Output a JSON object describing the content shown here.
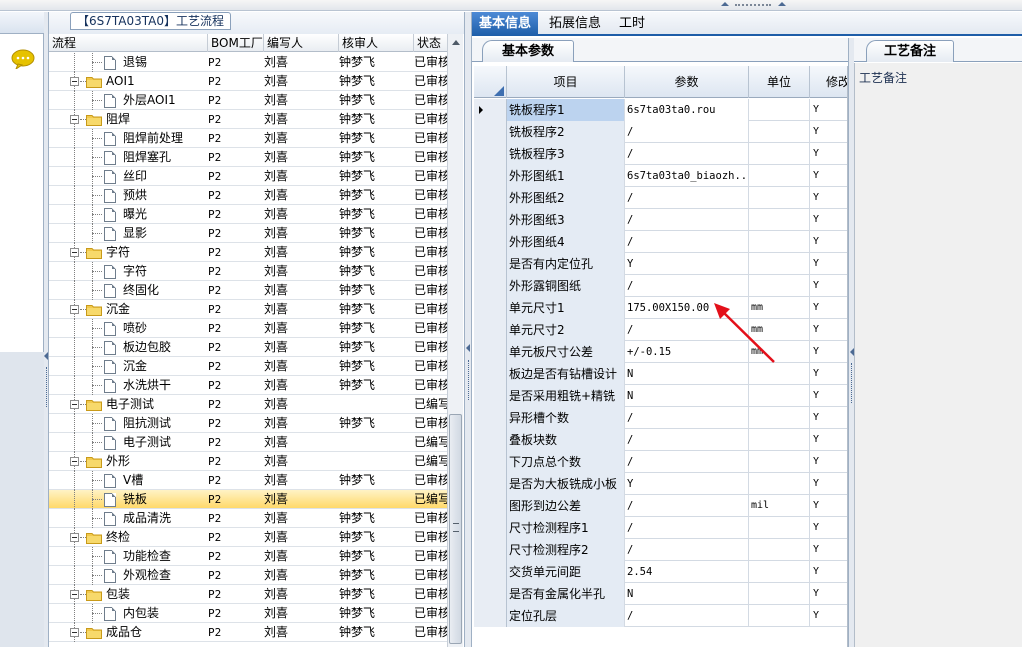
{
  "tree_panel": {
    "title": "【6S7TA03TA0】工艺流程",
    "columns": [
      "流程",
      "BOM工厂",
      "编写人",
      "核审人",
      "状态"
    ],
    "rows": [
      {
        "name": "退锡",
        "bom": "P2",
        "writer": "刘喜",
        "auditor": "钟梦飞",
        "status": "已审核",
        "level": 2,
        "type": "doc"
      },
      {
        "name": "AOI1",
        "bom": "P2",
        "writer": "刘喜",
        "auditor": "钟梦飞",
        "status": "已审核",
        "level": 1,
        "type": "folder"
      },
      {
        "name": "外层AOI1",
        "bom": "P2",
        "writer": "刘喜",
        "auditor": "钟梦飞",
        "status": "已审核",
        "level": 2,
        "type": "doc"
      },
      {
        "name": "阻焊",
        "bom": "P2",
        "writer": "刘喜",
        "auditor": "钟梦飞",
        "status": "已审核",
        "level": 1,
        "type": "folder"
      },
      {
        "name": "阻焊前处理",
        "bom": "P2",
        "writer": "刘喜",
        "auditor": "钟梦飞",
        "status": "已审核",
        "level": 2,
        "type": "doc"
      },
      {
        "name": "阻焊塞孔",
        "bom": "P2",
        "writer": "刘喜",
        "auditor": "钟梦飞",
        "status": "已审核",
        "level": 2,
        "type": "doc"
      },
      {
        "name": "丝印",
        "bom": "P2",
        "writer": "刘喜",
        "auditor": "钟梦飞",
        "status": "已审核",
        "level": 2,
        "type": "doc"
      },
      {
        "name": "预烘",
        "bom": "P2",
        "writer": "刘喜",
        "auditor": "钟梦飞",
        "status": "已审核",
        "level": 2,
        "type": "doc"
      },
      {
        "name": "曝光",
        "bom": "P2",
        "writer": "刘喜",
        "auditor": "钟梦飞",
        "status": "已审核",
        "level": 2,
        "type": "doc"
      },
      {
        "name": "显影",
        "bom": "P2",
        "writer": "刘喜",
        "auditor": "钟梦飞",
        "status": "已审核",
        "level": 2,
        "type": "doc"
      },
      {
        "name": "字符",
        "bom": "P2",
        "writer": "刘喜",
        "auditor": "钟梦飞",
        "status": "已审核",
        "level": 1,
        "type": "folder"
      },
      {
        "name": "字符",
        "bom": "P2",
        "writer": "刘喜",
        "auditor": "钟梦飞",
        "status": "已审核",
        "level": 2,
        "type": "doc"
      },
      {
        "name": "终固化",
        "bom": "P2",
        "writer": "刘喜",
        "auditor": "钟梦飞",
        "status": "已审核",
        "level": 2,
        "type": "doc"
      },
      {
        "name": "沉金",
        "bom": "P2",
        "writer": "刘喜",
        "auditor": "钟梦飞",
        "status": "已审核",
        "level": 1,
        "type": "folder"
      },
      {
        "name": "喷砂",
        "bom": "P2",
        "writer": "刘喜",
        "auditor": "钟梦飞",
        "status": "已审核",
        "level": 2,
        "type": "doc"
      },
      {
        "name": "板边包胶",
        "bom": "P2",
        "writer": "刘喜",
        "auditor": "钟梦飞",
        "status": "已审核",
        "level": 2,
        "type": "doc"
      },
      {
        "name": "沉金",
        "bom": "P2",
        "writer": "刘喜",
        "auditor": "钟梦飞",
        "status": "已审核",
        "level": 2,
        "type": "doc"
      },
      {
        "name": "水洗烘干",
        "bom": "P2",
        "writer": "刘喜",
        "auditor": "钟梦飞",
        "status": "已审核",
        "level": 2,
        "type": "doc"
      },
      {
        "name": "电子测试",
        "bom": "P2",
        "writer": "刘喜",
        "auditor": "",
        "status": "已编写",
        "level": 1,
        "type": "folder"
      },
      {
        "name": "阻抗测试",
        "bom": "P2",
        "writer": "刘喜",
        "auditor": "钟梦飞",
        "status": "已审核",
        "level": 2,
        "type": "doc"
      },
      {
        "name": "电子测试",
        "bom": "P2",
        "writer": "刘喜",
        "auditor": "",
        "status": "已编写",
        "level": 2,
        "type": "doc"
      },
      {
        "name": "外形",
        "bom": "P2",
        "writer": "刘喜",
        "auditor": "",
        "status": "已编写",
        "level": 1,
        "type": "folder"
      },
      {
        "name": "V槽",
        "bom": "P2",
        "writer": "刘喜",
        "auditor": "钟梦飞",
        "status": "已审核",
        "level": 2,
        "type": "doc"
      },
      {
        "name": "铣板",
        "bom": "P2",
        "writer": "刘喜",
        "auditor": "",
        "status": "已编写",
        "level": 2,
        "type": "doc",
        "selected": true
      },
      {
        "name": "成品清洗",
        "bom": "P2",
        "writer": "刘喜",
        "auditor": "钟梦飞",
        "status": "已审核",
        "level": 2,
        "type": "doc"
      },
      {
        "name": "终检",
        "bom": "P2",
        "writer": "刘喜",
        "auditor": "钟梦飞",
        "status": "已审核",
        "level": 1,
        "type": "folder"
      },
      {
        "name": "功能检查",
        "bom": "P2",
        "writer": "刘喜",
        "auditor": "钟梦飞",
        "status": "已审核",
        "level": 2,
        "type": "doc"
      },
      {
        "name": "外观检查",
        "bom": "P2",
        "writer": "刘喜",
        "auditor": "钟梦飞",
        "status": "已审核",
        "level": 2,
        "type": "doc"
      },
      {
        "name": "包装",
        "bom": "P2",
        "writer": "刘喜",
        "auditor": "钟梦飞",
        "status": "已审核",
        "level": 1,
        "type": "folder"
      },
      {
        "name": "内包装",
        "bom": "P2",
        "writer": "刘喜",
        "auditor": "钟梦飞",
        "status": "已审核",
        "level": 2,
        "type": "doc"
      },
      {
        "name": "成品仓",
        "bom": "P2",
        "writer": "刘喜",
        "auditor": "钟梦飞",
        "status": "已审核",
        "level": 1,
        "type": "folder"
      }
    ]
  },
  "main_tabs": [
    "基本信息",
    "拓展信息",
    "工时"
  ],
  "params": {
    "subtab": "基本参数",
    "columns": [
      "项目",
      "参数",
      "单位",
      "修改"
    ],
    "rows": [
      {
        "item": "铣板程序1",
        "value": "6s7ta03ta0.rou",
        "unit": "",
        "mod": "Y"
      },
      {
        "item": "铣板程序2",
        "value": "/",
        "unit": "",
        "mod": "Y"
      },
      {
        "item": "铣板程序3",
        "value": "/",
        "unit": "",
        "mod": "Y"
      },
      {
        "item": "外形图纸1",
        "value": "6s7ta03ta0_biaozh...",
        "unit": "",
        "mod": "Y"
      },
      {
        "item": "外形图纸2",
        "value": "/",
        "unit": "",
        "mod": "Y"
      },
      {
        "item": "外形图纸3",
        "value": "/",
        "unit": "",
        "mod": "Y"
      },
      {
        "item": "外形图纸4",
        "value": "/",
        "unit": "",
        "mod": "Y"
      },
      {
        "item": "是否有内定位孔",
        "value": "Y",
        "unit": "",
        "mod": "Y"
      },
      {
        "item": "外形露铜图纸",
        "value": "/",
        "unit": "",
        "mod": "Y"
      },
      {
        "item": "单元尺寸1",
        "value": "175.00X150.00",
        "unit": "mm",
        "mod": "Y"
      },
      {
        "item": "单元尺寸2",
        "value": "/",
        "unit": "mm",
        "mod": "Y"
      },
      {
        "item": "单元板尺寸公差",
        "value": "+/-0.15",
        "unit": "mm",
        "mod": "Y"
      },
      {
        "item": "板边是否有钻槽设计",
        "value": "N",
        "unit": "",
        "mod": "Y"
      },
      {
        "item": "是否采用粗铣+精铣",
        "value": "N",
        "unit": "",
        "mod": "Y"
      },
      {
        "item": "异形槽个数",
        "value": "/",
        "unit": "",
        "mod": "Y"
      },
      {
        "item": "叠板块数",
        "value": "/",
        "unit": "",
        "mod": "Y"
      },
      {
        "item": "下刀点总个数",
        "value": "/",
        "unit": "",
        "mod": "Y"
      },
      {
        "item": "是否为大板铣成小板",
        "value": "Y",
        "unit": "",
        "mod": "Y"
      },
      {
        "item": "图形到边公差",
        "value": "/",
        "unit": "mil",
        "mod": "Y"
      },
      {
        "item": "尺寸检测程序1",
        "value": "/",
        "unit": "",
        "mod": "Y"
      },
      {
        "item": "尺寸检测程序2",
        "value": "/",
        "unit": "",
        "mod": "Y"
      },
      {
        "item": "交货单元间距",
        "value": "2.54",
        "unit": "",
        "mod": "Y"
      },
      {
        "item": "是否有金属化半孔",
        "value": "N",
        "unit": "",
        "mod": "Y"
      },
      {
        "item": "定位孔层",
        "value": "/",
        "unit": "",
        "mod": "Y"
      }
    ]
  },
  "notes": {
    "tab": "工艺备注",
    "label": "工艺备注"
  },
  "colors": {
    "accent": "#1d5da8",
    "selection": "#ffd96a",
    "annotation": "#e3101a"
  },
  "icons": {
    "chat": "speech-bubble-icon",
    "folder": "folder-icon",
    "doc": "document-icon"
  }
}
